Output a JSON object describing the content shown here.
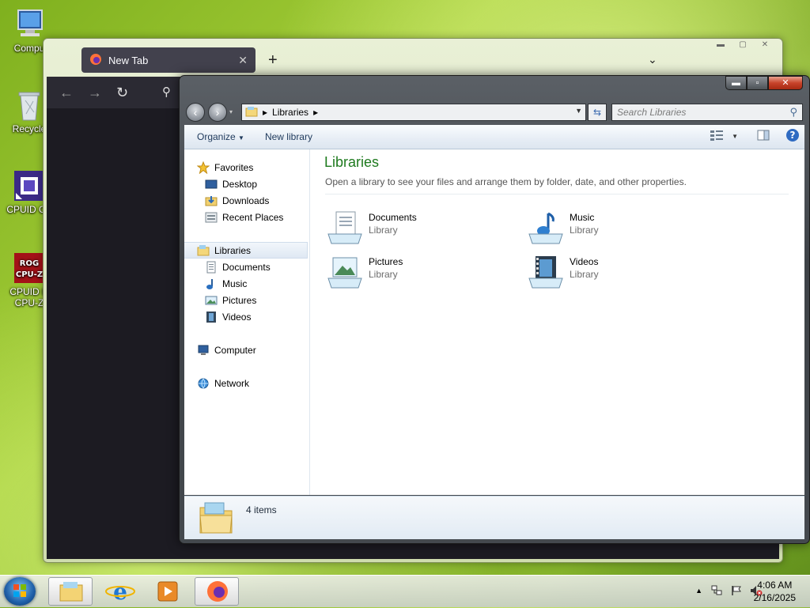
{
  "desktop": {
    "icons": [
      {
        "label": "Compu",
        "icon": "computer-icon"
      },
      {
        "label": "Recycle",
        "icon": "recycle-bin-icon"
      },
      {
        "label": "CPUID CP",
        "icon": "cpuid-icon"
      },
      {
        "label": "CPUID R",
        "label2": "CPU-Z",
        "icon": "cpu-z-icon"
      }
    ]
  },
  "firefox": {
    "tab_title": "New Tab",
    "tab_close": "✕",
    "new_tab": "+",
    "list_all_tabs": "⌄",
    "icons": [
      "firefox-icon",
      "back-icon",
      "forward-icon",
      "reload-icon",
      "search-icon"
    ]
  },
  "explorer": {
    "caption": {
      "minimize": "▬",
      "maximize": "▫",
      "close": "✕"
    },
    "address": {
      "root_arrow": "▸",
      "location": "Libraries",
      "trail_arrow": "▸"
    },
    "search_placeholder": "Search Libraries",
    "toolbar": {
      "organize": "Organize",
      "new_library": "New library"
    },
    "navigation": {
      "favorites": "Favorites",
      "favorites_items": [
        "Desktop",
        "Downloads",
        "Recent Places"
      ],
      "libraries": "Libraries",
      "libraries_items": [
        "Documents",
        "Music",
        "Pictures",
        "Videos"
      ],
      "computer": "Computer",
      "network": "Network"
    },
    "content": {
      "title": "Libraries",
      "description": "Open a library to see your files and arrange them by folder, date, and other properties.",
      "libraries": [
        {
          "name": "Documents",
          "type": "Library",
          "icon": "documents-library-icon"
        },
        {
          "name": "Music",
          "type": "Library",
          "icon": "music-library-icon"
        },
        {
          "name": "Pictures",
          "type": "Library",
          "icon": "pictures-library-icon"
        },
        {
          "name": "Videos",
          "type": "Library",
          "icon": "videos-library-icon"
        }
      ]
    },
    "details": {
      "item_count": "4 items"
    }
  },
  "taskbar": {
    "apps": [
      "windows-explorer",
      "internet-explorer",
      "media-player",
      "firefox"
    ],
    "tray_expand": "▲",
    "clock_time": "4:06 AM",
    "clock_date": "2/16/2025"
  },
  "colors": {
    "library_title": "#1e7a1e",
    "firefox_tab": "#42414d",
    "close_button": "#c7432a"
  }
}
